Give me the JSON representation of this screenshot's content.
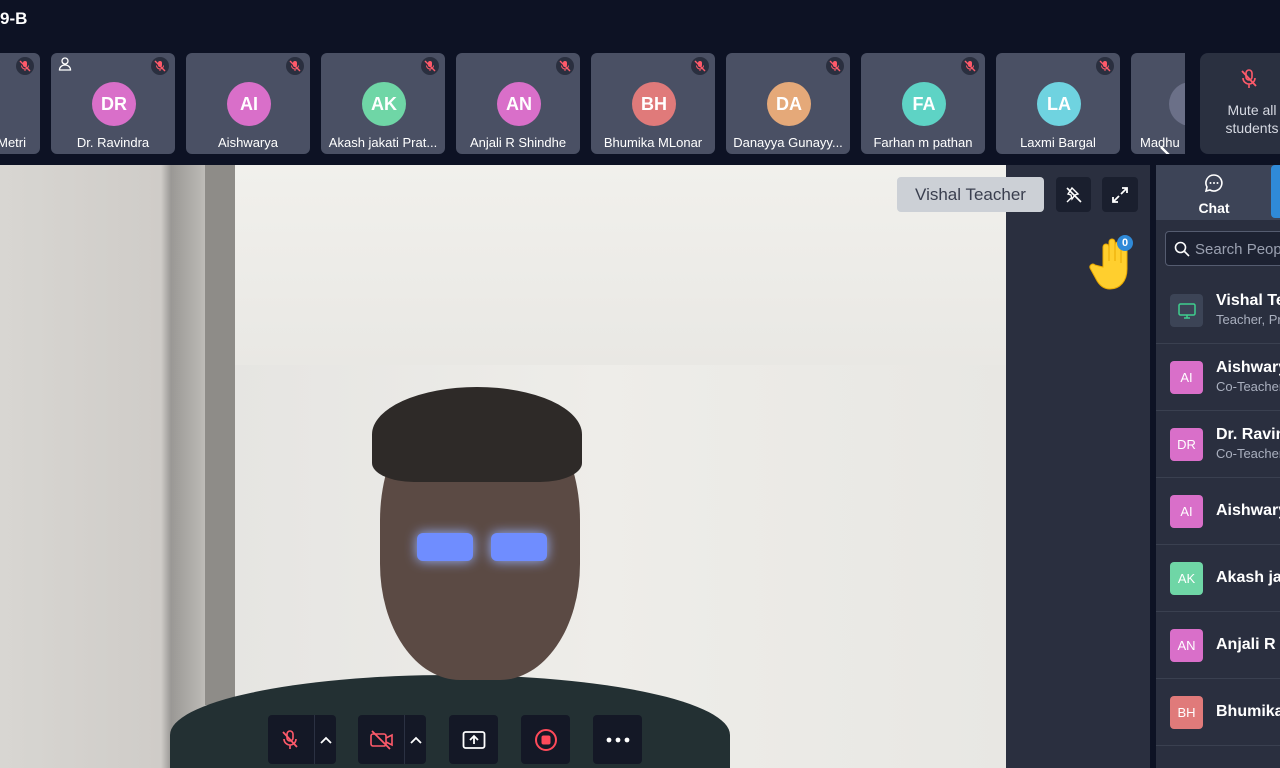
{
  "header": {
    "class_title": "9-B"
  },
  "participants": [
    {
      "name": "Metri",
      "initials": "",
      "color": "#e26fa0"
    },
    {
      "name": "Dr. Ravindra",
      "initials": "DR",
      "color": "#d96fc9"
    },
    {
      "name": "Aishwarya",
      "initials": "AI",
      "color": "#d96fc9"
    },
    {
      "name": "Akash jakati Prat...",
      "initials": "AK",
      "color": "#6fd6a6"
    },
    {
      "name": "Anjali R Shindhe",
      "initials": "AN",
      "color": "#d96fc9"
    },
    {
      "name": "Bhumika MLonar",
      "initials": "BH",
      "color": "#e07a7a"
    },
    {
      "name": "Danayya Gunayy...",
      "initials": "DA",
      "color": "#e5a979"
    },
    {
      "name": "Farhan m pathan",
      "initials": "FA",
      "color": "#5ed3c5"
    },
    {
      "name": "Laxmi Bargal",
      "initials": "LA",
      "color": "#6fd3e0"
    },
    {
      "name": "Madhu",
      "initials": "",
      "color": "#6b7088"
    }
  ],
  "mute_all": {
    "label": "Mute all students"
  },
  "video": {
    "speaker_label": "Vishal Teacher",
    "raised_hands": "0"
  },
  "sidebar": {
    "tab_chat": "Chat",
    "search_placeholder": "Search People",
    "people": [
      {
        "name": "Vishal Tea",
        "role": "Teacher, Pr",
        "initials": "",
        "color": "#3c4456"
      },
      {
        "name": "Aishwary",
        "role": "Co-Teacher",
        "initials": "AI",
        "color": "#d96fc9"
      },
      {
        "name": "Dr. Ravin",
        "role": "Co-Teacher",
        "initials": "DR",
        "color": "#d96fc9"
      },
      {
        "name": "Aishwary",
        "role": "",
        "initials": "AI",
        "color": "#d96fc9"
      },
      {
        "name": "Akash jak",
        "role": "",
        "initials": "AK",
        "color": "#6fd6a6"
      },
      {
        "name": "Anjali R S",
        "role": "",
        "initials": "AN",
        "color": "#d96fc9"
      },
      {
        "name": "Bhumika",
        "role": "",
        "initials": "BH",
        "color": "#e07a7a"
      }
    ]
  }
}
